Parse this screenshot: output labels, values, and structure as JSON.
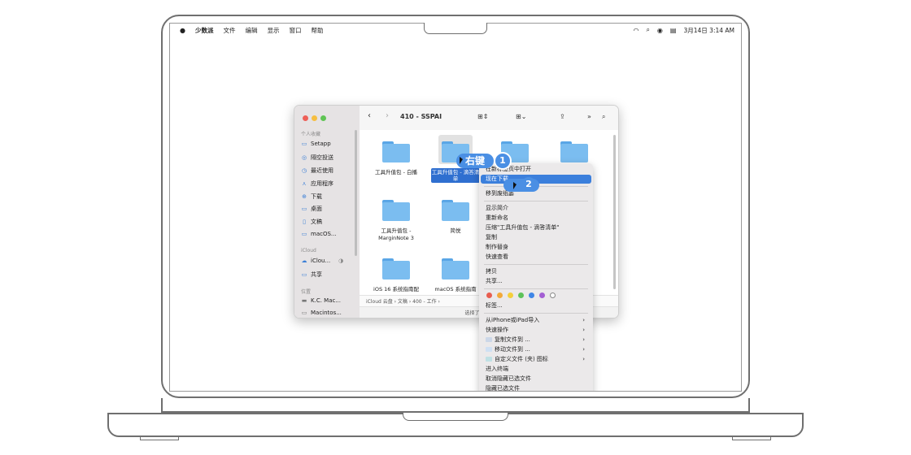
{
  "menubar": {
    "apple_icon": "apple-logo-icon",
    "app_name": "少数派",
    "menus": [
      "文件",
      "编辑",
      "显示",
      "窗口",
      "帮助"
    ],
    "status_icons": [
      "wifi-icon",
      "search-icon",
      "user-icon",
      "control-center-icon"
    ],
    "datetime": "3月14日  3:14 AM"
  },
  "finder": {
    "title": "410 - SSPAI",
    "sidebar": {
      "section_favorites": "个人收藏",
      "favorites": [
        "Setapp",
        "隔空投送",
        "最近使用",
        "应用程序",
        "下载",
        "桌面",
        "文稿",
        "macOS..."
      ],
      "section_icloud": "iCloud",
      "icloud": [
        "iClou...",
        "共享"
      ],
      "section_locations": "位置",
      "locations": [
        "K.C. Mac...",
        "Macintos..."
      ]
    },
    "files": [
      {
        "name": "工具升值包 - 白播"
      },
      {
        "name": "工具升值包 - 滴答清单"
      },
      {
        "name": "工具升值包 - MarginNote 3"
      },
      {
        "name": "简悦"
      },
      {
        "name": "iOS 16 系统指南配"
      },
      {
        "name": "macOS 系统指南"
      }
    ],
    "pathbar": "iCloud 云盘 › 文稿 › 400 - 工作 ›",
    "status": "选择了 1 项（共 11 项"
  },
  "context_menu": {
    "items_group1": [
      "在新标签页中打开",
      "现在下载",
      "移到废纸篓"
    ],
    "items_group2": [
      "显示简介",
      "重新命名",
      "压缩\"工具升值包 - 滴答清单\"",
      "复制",
      "制作替身",
      "快速查看"
    ],
    "items_group3": [
      "拷贝",
      "共享..."
    ],
    "tag_colors": [
      "#e85d4f",
      "#f2a93b",
      "#f4cf3c",
      "#5ec25a",
      "#3f86e6",
      "#a35fd3"
    ],
    "tags_label": "标签...",
    "items_group4": [
      "从iPhone或iPad导入",
      "快速操作",
      "复制文件到 ...",
      "移动文件到 ...",
      "自定义文件 (夹) 图标",
      "进入终端",
      "取消隐藏已选文件",
      "隐藏已选文件"
    ]
  },
  "annotations": {
    "step1_label": "右键",
    "step1_number": "1",
    "step2_number": "2"
  }
}
